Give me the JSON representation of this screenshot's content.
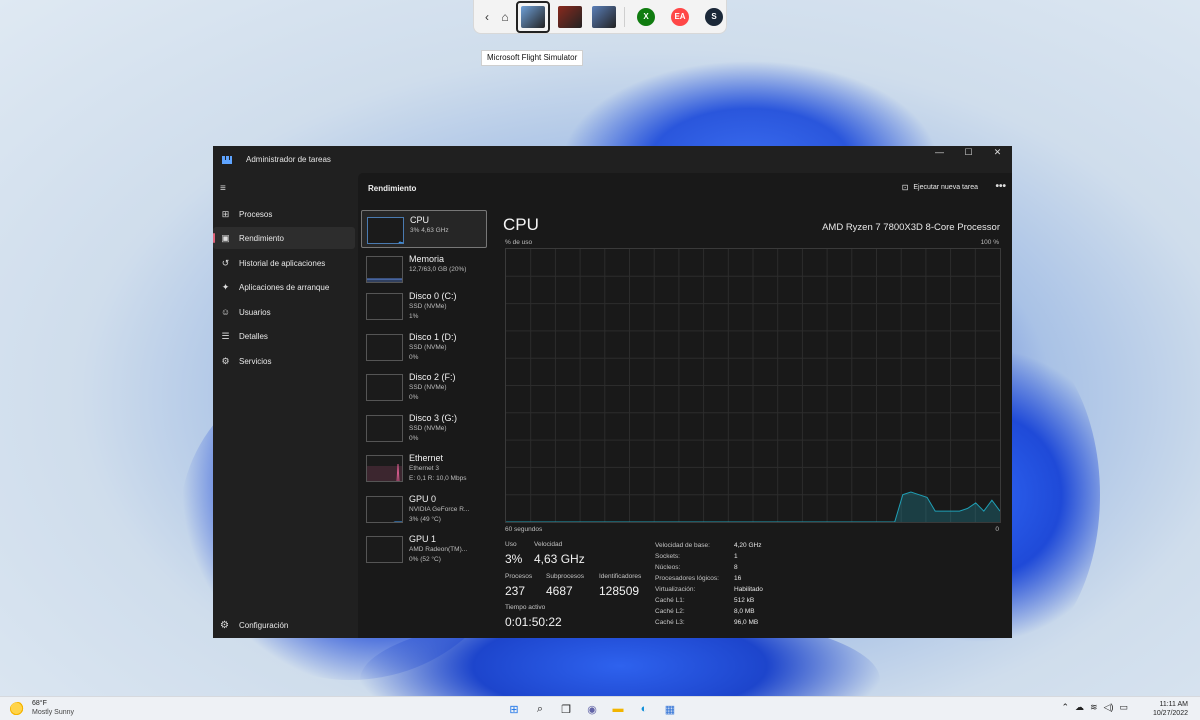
{
  "launcher": {
    "back_glyph": "‹",
    "home_glyph": "⌂",
    "games": [
      {
        "name": "flight-simulator-tile",
        "selected": true,
        "color": "#6fa0d8"
      },
      {
        "name": "game-tile-red",
        "selected": false,
        "color": "#8a2a1e"
      },
      {
        "name": "game-tile-forza",
        "selected": false,
        "color": "#5a7fb8"
      }
    ],
    "stores": [
      {
        "name": "xbox-icon",
        "glyph": "X",
        "color": "#107c10"
      },
      {
        "name": "ea-icon",
        "glyph": "EA",
        "color": "#ff4747"
      },
      {
        "name": "steam-icon",
        "glyph": "S",
        "color": "#1b2838"
      }
    ],
    "tooltip": "Microsoft Flight Simulator"
  },
  "window": {
    "title": "Administrador de tareas",
    "controls": {
      "minimize": "—",
      "maximize": "☐",
      "close": "✕"
    }
  },
  "nav": {
    "menu_glyph": "≡",
    "items": [
      {
        "label": "Procesos",
        "icon": "⊞"
      },
      {
        "label": "Rendimiento",
        "icon": "▣"
      },
      {
        "label": "Historial de aplicaciones",
        "icon": "↺"
      },
      {
        "label": "Aplicaciones de arranque",
        "icon": "✦"
      },
      {
        "label": "Usuarios",
        "icon": "☺"
      },
      {
        "label": "Detalles",
        "icon": "☰"
      },
      {
        "label": "Servicios",
        "icon": "⚙"
      }
    ],
    "settings_label": "Configuración",
    "settings_icon": "⚙"
  },
  "header": {
    "title": "Rendimiento",
    "run_task": "Ejecutar nueva tarea",
    "run_icon": "⊡",
    "more": "•••"
  },
  "devices": [
    {
      "name": "CPU",
      "sub1": "3% 4,63 GHz",
      "sub2": "",
      "sub3": "",
      "accent": "#3fa0ff"
    },
    {
      "name": "Memoria",
      "sub1": "12,7/63,0 GB (20%)",
      "sub2": "",
      "sub3": "",
      "accent": "#5c88e0"
    },
    {
      "name": "Disco 0 (C:)",
      "sub1": "SSD (NVMe)",
      "sub2": "1%",
      "sub3": "",
      "accent": "#6fbf4a"
    },
    {
      "name": "Disco 1 (D:)",
      "sub1": "SSD (NVMe)",
      "sub2": "0%",
      "sub3": "",
      "accent": "#6fbf4a"
    },
    {
      "name": "Disco 2 (F:)",
      "sub1": "SSD (NVMe)",
      "sub2": "0%",
      "sub3": "",
      "accent": "#6fbf4a"
    },
    {
      "name": "Disco 3 (G:)",
      "sub1": "SSD (NVMe)",
      "sub2": "0%",
      "sub3": "",
      "accent": "#6fbf4a"
    },
    {
      "name": "Ethernet",
      "sub1": "Ethernet 3",
      "sub2": "E: 0,1 R: 10,0 Mbps",
      "sub3": "",
      "accent": "#d25a8a"
    },
    {
      "name": "GPU 0",
      "sub1": "NVIDIA GeForce R...",
      "sub2": "3% (49 °C)",
      "sub3": "",
      "accent": "#3fa0ff"
    },
    {
      "name": "GPU 1",
      "sub1": "AMD Radeon(TM)...",
      "sub2": "0% (52 °C)",
      "sub3": "",
      "accent": "#3fa0ff"
    }
  ],
  "cpu": {
    "title": "CPU",
    "model": "AMD Ryzen 7 7800X3D 8-Core Processor",
    "y_label": "% de uso",
    "y_max": "100 %",
    "x_label": "60 segundos",
    "x_min": "0",
    "stats": {
      "uso_label": "Uso",
      "uso": "3%",
      "vel_label": "Velocidad",
      "vel": "4,63 GHz",
      "proc_label": "Procesos",
      "proc": "237",
      "sub_label": "Subprocesos",
      "sub": "4687",
      "ident_label": "Identificadores",
      "ident": "128509",
      "tiempo_label": "Tiempo activo",
      "tiempo": "0:01:50:22"
    },
    "props": [
      {
        "k": "Velocidad de base:",
        "v": "4,20 GHz"
      },
      {
        "k": "Sockets:",
        "v": "1"
      },
      {
        "k": "Núcleos:",
        "v": "8"
      },
      {
        "k": "Procesadores lógicos:",
        "v": "16"
      },
      {
        "k": "Virtualización:",
        "v": "Habilitado"
      },
      {
        "k": "Caché L1:",
        "v": "512 kB"
      },
      {
        "k": "Caché L2:",
        "v": "8,0 MB"
      },
      {
        "k": "Caché L3:",
        "v": "96,0 MB"
      }
    ],
    "usage_history": [
      0,
      0,
      0,
      0,
      0,
      0,
      0,
      0,
      0,
      0,
      0,
      0,
      0,
      0,
      0,
      0,
      0,
      0,
      0,
      0,
      0,
      0,
      0,
      0,
      0,
      0,
      0,
      0,
      0,
      0,
      0,
      0,
      0,
      0,
      0,
      0,
      0,
      0,
      0,
      0,
      0,
      0,
      0,
      0,
      0,
      0,
      0,
      0,
      0,
      10,
      11,
      10,
      9,
      4,
      4,
      4,
      4,
      5,
      7,
      4,
      8,
      4
    ],
    "line_color": "#1f9fb5"
  },
  "taskbar": {
    "temp": "68°F",
    "condition": "Mostly Sunny",
    "apps": [
      {
        "name": "start-icon",
        "glyph": "⊞",
        "color": "#1a73e8"
      },
      {
        "name": "search-icon",
        "glyph": "⌕",
        "color": "#222222"
      },
      {
        "name": "task-view-icon",
        "glyph": "❐",
        "color": "#222222"
      },
      {
        "name": "chat-icon",
        "glyph": "◉",
        "color": "#6264a7"
      },
      {
        "name": "file-explorer-icon",
        "glyph": "▬",
        "color": "#f2b500"
      },
      {
        "name": "edge-icon",
        "glyph": "◐",
        "color": "#0f8fd8"
      },
      {
        "name": "store-icon",
        "glyph": "▦",
        "color": "#2b6fd6"
      }
    ],
    "tray": [
      "⌃",
      "☁",
      "≋",
      "◁)",
      "▭"
    ],
    "time": "11:11 AM",
    "date": "10/27/2022"
  }
}
